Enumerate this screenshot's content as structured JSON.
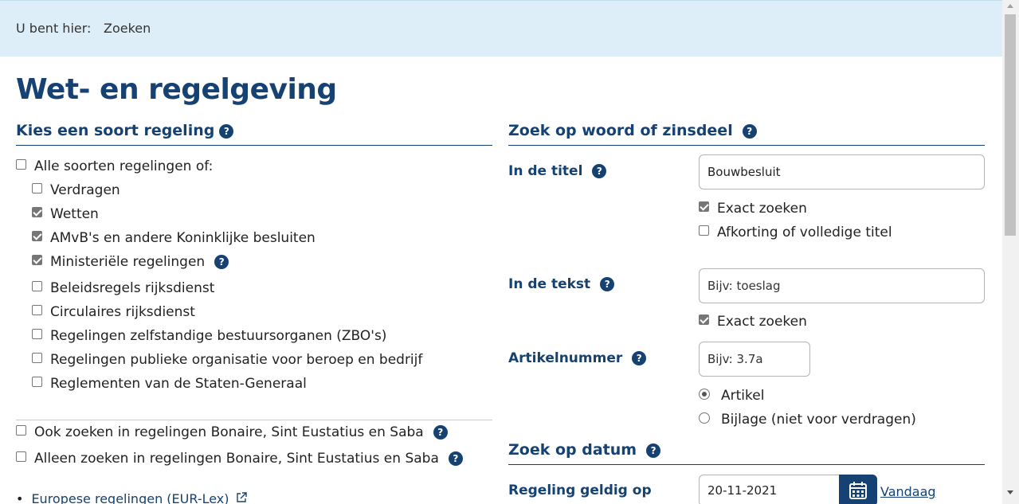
{
  "breadcrumb": {
    "label": "U bent hier:",
    "current": "Zoeken"
  },
  "page_title": "Wet- en regelgeving",
  "left": {
    "section_title": "Kies een soort regeling",
    "help": "?",
    "all_types": {
      "label": "Alle soorten regelingen of:",
      "checked": false
    },
    "types": [
      {
        "label": "Verdragen",
        "checked": false
      },
      {
        "label": "Wetten",
        "checked": true
      },
      {
        "label": "AMvB's en andere Koninklijke besluiten",
        "checked": true
      },
      {
        "label": "Ministeriële regelingen",
        "checked": true
      },
      {
        "label": "Beleidsregels rijksdienst",
        "checked": false
      },
      {
        "label": "Circulaires rijksdienst",
        "checked": false
      },
      {
        "label": "Regelingen zelfstandige bestuursorganen (ZBO's)",
        "checked": false
      },
      {
        "label": "Regelingen publieke organisatie voor beroep en bedrijf",
        "checked": false
      },
      {
        "label": "Reglementen van de Staten-Generaal",
        "checked": false
      }
    ],
    "bes_also": "Ook zoeken in regelingen Bonaire, Sint Eustatius en Saba",
    "bes_only": "Alleen zoeken in regelingen Bonaire, Sint Eustatius en Saba",
    "eurlex_link": "Europese regelingen (EUR-Lex)"
  },
  "right": {
    "word_section_title": "Zoek op woord of zinsdeel",
    "title_label": "In de titel",
    "title_value": "Bouwbesluit",
    "title_exact": "Exact zoeken",
    "title_abbrev": "Afkorting of volledige titel",
    "text_label": "In de tekst",
    "text_placeholder": "Bijv: toeslag",
    "text_exact": "Exact zoeken",
    "article_label": "Artikelnummer",
    "article_placeholder": "Bijv: 3.7a",
    "radio_article": "Artikel",
    "radio_annex": "Bijlage (niet voor verdragen)",
    "date_section_title": "Zoek op datum",
    "valid_label": "Regeling geldig op",
    "valid_value": "20-11-2021",
    "today_link": "Vandaag"
  },
  "colors": {
    "brand": "#154273",
    "breadcrumb_bg": "#ddeef8"
  }
}
